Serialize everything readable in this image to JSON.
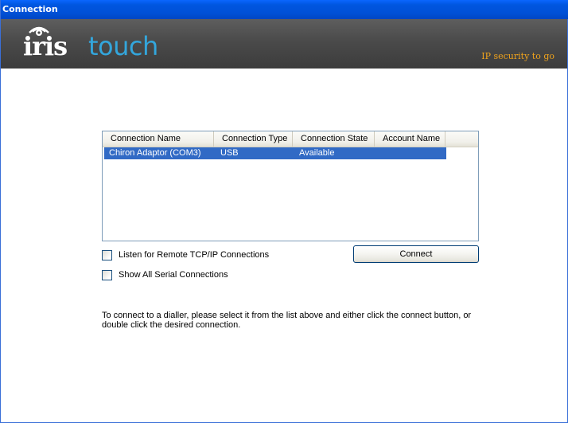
{
  "window": {
    "title": "Connection"
  },
  "banner": {
    "logo_iris": "iris",
    "logo_touch": "touch",
    "tagline": "IP security to go",
    "colors": {
      "background": "#4a4a4a",
      "touch": "#33a6dc",
      "tagline": "#f0a31c"
    }
  },
  "connections": {
    "columns": [
      "Connection Name",
      "Connection Type",
      "Connection State",
      "Account Name"
    ],
    "rows": [
      {
        "name": "Chiron Adaptor (COM3)",
        "type": "USB",
        "state": "Available",
        "account": "",
        "selected": true
      }
    ]
  },
  "options": {
    "listen_label": "Listen for Remote TCP/IP Connections",
    "listen_checked": false,
    "show_all_label": "Show All Serial Connections",
    "show_all_checked": false
  },
  "actions": {
    "connect_label": "Connect"
  },
  "instructions": "To connect to a dialler, please select it from the list above and either click the connect button, or double click the desired connection.",
  "colors": {
    "titlebar": "#0054e3",
    "selection": "#316ac5"
  }
}
